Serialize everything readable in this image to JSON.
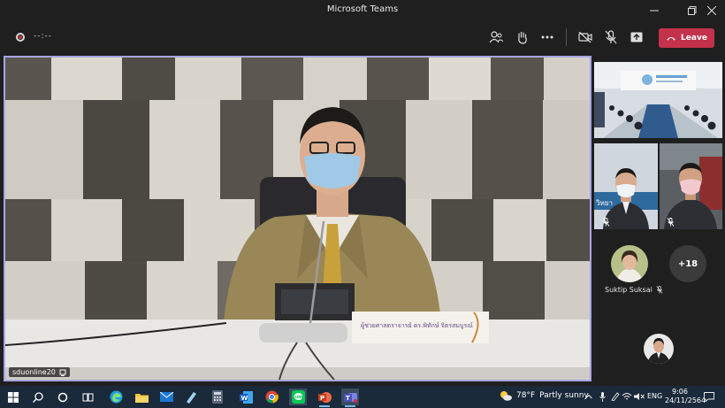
{
  "window": {
    "title": "Microsoft Teams",
    "minimize_icon": "minimize-icon",
    "maximize_icon": "maximize-icon",
    "close_icon": "close-icon"
  },
  "toolbar": {
    "recording_icon": "record-icon",
    "timer": "--:--",
    "people_icon": "people-icon",
    "raise_hand_icon": "raise-hand-icon",
    "more_icon": "more-icon",
    "camera_icon": "camera-off-icon",
    "mic_icon": "mic-off-icon",
    "share_icon": "share-icon",
    "leave_label": "Leave",
    "leave_color": "#c4314b"
  },
  "main_video": {
    "participant_name": "sduonline20",
    "nameplate_text": "ผู้ช่วยศาสตราจารย์ ดร.พิทักษ์ จิตรสมบูรณ์"
  },
  "side_panel": {
    "participant_name": "Suktip Suksai",
    "overflow_count": "+18"
  },
  "taskbar": {
    "weather_temp": "78°F",
    "weather_text": "Partly sunny",
    "language": "ENG",
    "time": "9:06",
    "date": "24/11/2564"
  }
}
